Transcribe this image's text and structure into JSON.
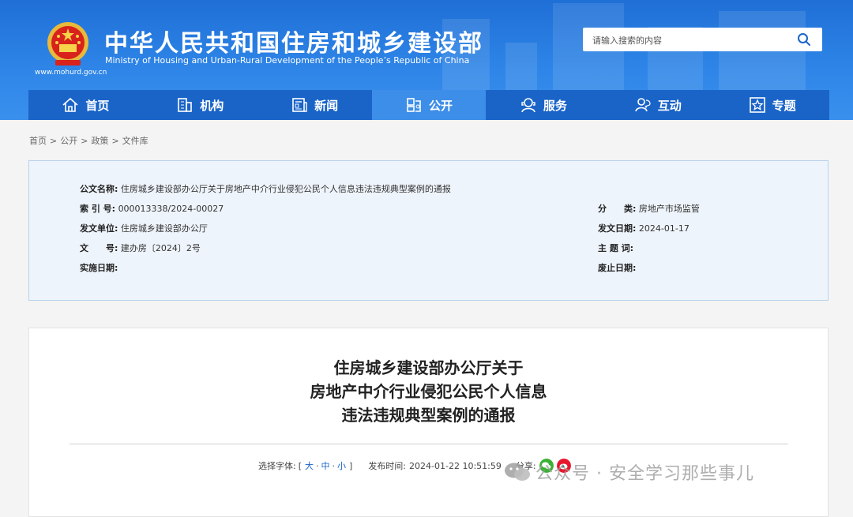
{
  "header": {
    "title": "中华人民共和国住房和城乡建设部",
    "subtitle": "Ministry of Housing and Urban-Rural Development of the People’s Republic of China",
    "url": "www.mohurd.gov.cn",
    "search_placeholder": "请输入搜索的内容"
  },
  "nav": {
    "items": [
      {
        "label": "首页",
        "icon": "home-icon"
      },
      {
        "label": "机构",
        "icon": "building-icon"
      },
      {
        "label": "新闻",
        "icon": "news-icon"
      },
      {
        "label": "公开",
        "icon": "open-icon"
      },
      {
        "label": "服务",
        "icon": "service-icon"
      },
      {
        "label": "互动",
        "icon": "interact-icon"
      },
      {
        "label": "专题",
        "icon": "topic-icon"
      }
    ],
    "active_index": 3
  },
  "breadcrumb": [
    "首页",
    "公开",
    "政策",
    "文件库"
  ],
  "meta": {
    "title_key": "公文名称:",
    "title_val": "住房城乡建设部办公厅关于房地产中介行业侵犯公民个人信息违法违规典型案例的通报",
    "index_key": "索 引 号:",
    "index_val": "000013338/2024-00027",
    "category_key": "分　　类:",
    "category_val": "房地产市场监管",
    "issuer_key": "发文单位:",
    "issuer_val": "住房城乡建设部办公厅",
    "date_key": "发文日期:",
    "date_val": "2024-01-17",
    "docno_key": "文　　号:",
    "docno_val": "建办房〔2024〕2号",
    "keyword_key": "主 题 词:",
    "keyword_val": "",
    "effective_key": "实施日期:",
    "effective_val": "",
    "expire_key": "废止日期:",
    "expire_val": ""
  },
  "article": {
    "title_lines": [
      "住房城乡建设部办公厅关于",
      "房地产中介行业侵犯公民个人信息",
      "违法违规典型案例的通报"
    ],
    "font_label": "选择字体:",
    "font_open": "[",
    "font_large": "大",
    "font_medium": "中",
    "font_small": "小",
    "font_close": "]",
    "publish_label": "发布时间:",
    "publish_time": "2024-01-22 10:51:59",
    "share_label": "分享:"
  },
  "watermark": "公众号 · 安全学习那些事儿",
  "colors": {
    "header_blue": "#2f86e8",
    "nav_blue": "#1a64c8",
    "nav_active": "#3d8ee8",
    "meta_bg": "#eef4fb",
    "wechat_green": "#3cb034",
    "weibo_red": "#e6162d"
  }
}
